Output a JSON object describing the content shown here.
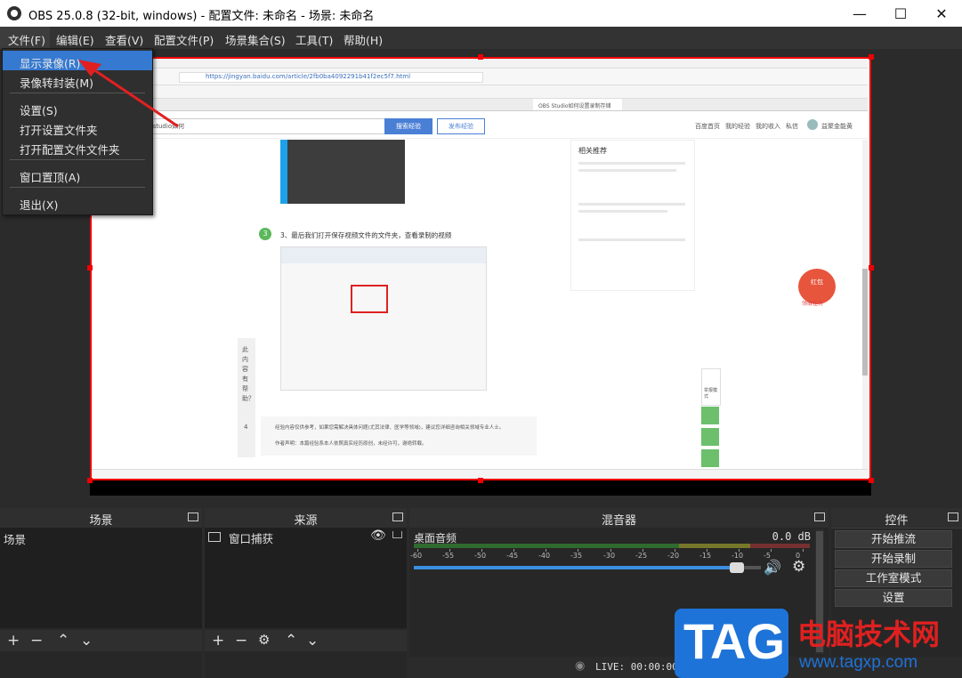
{
  "window": {
    "title": "OBS 25.0.8 (32-bit, windows) - 配置文件: 未命名 - 场景: 未命名",
    "minimize": "—",
    "maximize": "☐",
    "close": "✕"
  },
  "menu": [
    "文件(F)",
    "编辑(E)",
    "查看(V)",
    "配置文件(P)",
    "场景集合(S)",
    "工具(T)",
    "帮助(H)"
  ],
  "file_menu": {
    "items": [
      "显示录像(R)",
      "录像转封装(M)",
      "设置(S)",
      "打开设置文件夹",
      "打开配置文件文件夹",
      "窗口置顶(A)",
      "退出(X)"
    ],
    "active_index": 0
  },
  "browser": {
    "url": "https://jingyan.baidu.com/article/2fb0ba4092291b41f2ec5f7.html",
    "search_text": "obs studio如何",
    "search_button": "搜索经验",
    "publish_button": "发布经验",
    "top_links": [
      "百度首页",
      "我的经验",
      "我的收入",
      "私信"
    ],
    "user": "益聚金能黄",
    "step_number": "3",
    "step_text": "3、最后我们打开保存视频文件的文件夹，查看录制的视频",
    "related_title": "相关推荐",
    "tab_active": "OBS Studio如何设置录制存储",
    "sidebar_text": "此内容有帮助？",
    "notes": [
      "经验内容仅供参考，如果您需解决具体问题(尤其法律、医学等领域)，建议您详细咨询相关领域专业人士。",
      "作者声明：本篇经验系本人依照真实经历原创，未经许可，谢绝转载。"
    ],
    "float_labels": [
      "红包",
      "领取任务",
      "举报模式"
    ],
    "like_count": "4"
  },
  "scenes": {
    "header": "场景",
    "items": [
      "场景"
    ]
  },
  "sources": {
    "header": "来源",
    "items": [
      {
        "label": "窗口捕获"
      }
    ]
  },
  "mixer": {
    "header": "混音器",
    "channel_name": "桌面音频",
    "db_value": "0.0 dB",
    "scale": [
      "-60",
      "-55",
      "-50",
      "-45",
      "-40",
      "-35",
      "-30",
      "-25",
      "-20",
      "-15",
      "-10",
      "-5",
      "0"
    ],
    "volume_fraction": 0.95
  },
  "controls": {
    "header": "控件",
    "buttons": [
      "开始推流",
      "开始录制",
      "工作室模式",
      "设置"
    ]
  },
  "status": {
    "live": "LIVE: 00:00:00"
  },
  "watermark": {
    "tag": "TAG",
    "site_name": "电脑技术网",
    "url": "www.tagxp.com"
  },
  "colors": {
    "accent": "#3579d0",
    "selection": "#ee0000",
    "meter_green": "#3a8a3a",
    "meter_yellow": "#8a8a2a",
    "meter_red": "#8a2a2a"
  }
}
